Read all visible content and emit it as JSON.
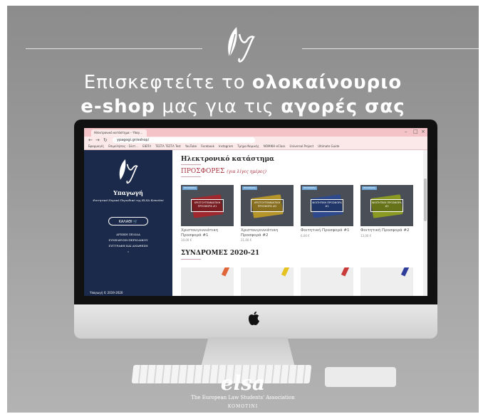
{
  "headline": {
    "line1_normal": "Επισκεφτείτε το ",
    "line1_bold": "ολοκαίνουριο",
    "line2_bold": "e-shop",
    "line2_normal": " μας για τις ",
    "line2_bold2": "αγορές σας"
  },
  "browser": {
    "tab_title": "Ηλεκτρονικό κατάστημα – Υπαγ...",
    "url": "ypagogi.gr/eshop/",
    "bookmarks": [
      "Εφαρμογές",
      "Επιμελήσεις - Σύστ...",
      "ΕΙΕΠΛ",
      "ΤΕΣΤΑ ΤΕΣΤΑ Test",
      "YouTube",
      "Facebook",
      "Instagram",
      "Τμήμα Νομικής",
      "ΝΟΜΙΚΗ eClass",
      "Universal Project",
      "Ultimate Guide"
    ]
  },
  "sidebar": {
    "title": "Υπαγωγή",
    "subtitle": "Φοιτητικό Νομικό Περιοδικό της ELSA Komotini",
    "cart_label": "ΚΑΛΑΘΙ 🛒",
    "menu": [
      "ΑΡΧΙΚΗ ΣΕΛΙΔΑ",
      "ΣΥΝΕΛΕΥΣΗ ΠΕΡΙΟΔΙΚΟΥ",
      "ΣΥΓΓΡΑΦΗ ΚΑΙ ΑΝΑΘΕΣΗ",
      "»"
    ],
    "footer": "Υπαγωγή © 2019-2020"
  },
  "store": {
    "title": "Ηλεκτρονικό κατάστημα",
    "offers_title": "ΠΡΟΣΦΟΡΕΣ",
    "offers_note": "(για λίγες ημέρες)",
    "subscriptions_title": "ΣΥΝΔΡΟΜΕΣ 2020-21",
    "products": [
      {
        "tag": "ΠΡΟΣΦΟΡΑ",
        "badge": "ΧΡΙΣΤΟΥΓΕΝΝΙΑΤΙΚΗ ΠΡΟΣΦΟΡΑ #1",
        "name": "Χριστουγεννιάτικη Προσφορά #1",
        "price": "10,00 €",
        "book_color": "#a0282f"
      },
      {
        "tag": "ΠΡΟΣΦΟΡΑ",
        "badge": "ΧΡΙΣΤΟΥΓΕΝΝΙΑΤΙΚΗ ΠΡΟΣΦΟΡΑ #2",
        "name": "Χριστουγεννιάτικη Προσφορά #2",
        "price": "21,00 €",
        "book_color": "#b6952a"
      },
      {
        "tag": "ΠΡΟΣΦΟΡΑ",
        "badge": "ΦΟΙΤΗΤΙΚΗ ΠΡΟΣΦΟΡΑ #1",
        "name": "Φοιτητική Προσφορά #1",
        "price": "6,00 €",
        "book_color": "#2e4a8c"
      },
      {
        "tag": "ΠΡΟΣΦΟΡΑ",
        "badge": "ΦΟΙΤΗΤΙΚΗ ΠΡΟΣΦΟΡΑ #2",
        "name": "Φοιτητική Προσφορά #2",
        "price": "13,00 €",
        "book_color": "#8a9a22"
      }
    ],
    "subscription_stripes": [
      "#e0663a",
      "#e6c21e",
      "#c93a3a",
      "#2e3e9a"
    ]
  },
  "footer": {
    "logo": "elsa",
    "org": "The European Law Students' Association",
    "city": "KOMOTINI"
  }
}
